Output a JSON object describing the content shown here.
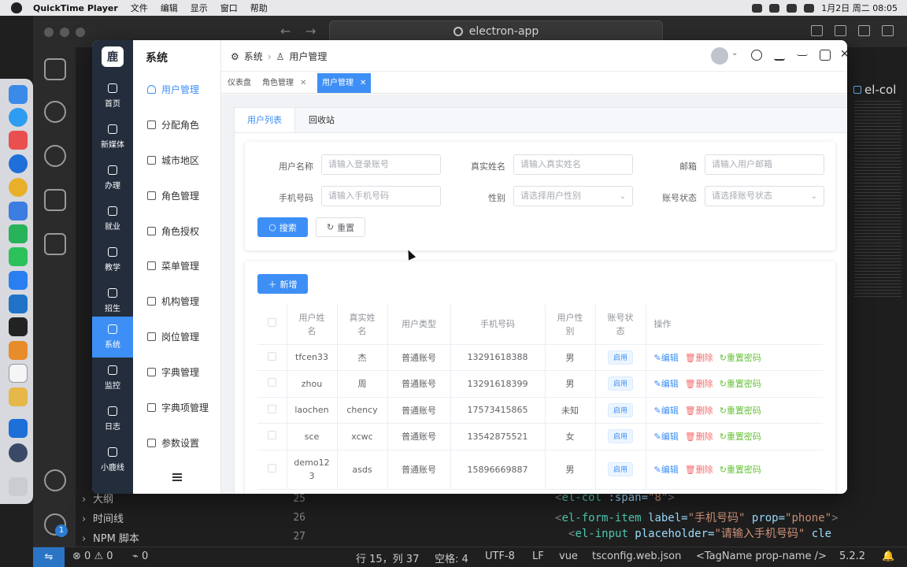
{
  "menubar": {
    "app": "QuickTime Player",
    "items": [
      "文件",
      "编辑",
      "显示",
      "窗口",
      "帮助"
    ],
    "clock": "1月2日 周二  08:05"
  },
  "vscode": {
    "search": "electron-app",
    "right_tab": "el-col",
    "sidebar_items": [
      "大纲",
      "时间线",
      "NPM 脚本"
    ],
    "lines": [
      "25",
      "26",
      "27"
    ],
    "code": {
      "l25": {
        "open": "<",
        "tag": "el-col",
        "attr": " :span=",
        "val": "\"8\"",
        "close": ">"
      },
      "l26": {
        "open": "<",
        "tag": "el-form-item",
        "attr1": " label=",
        "val1": "\"手机号码\"",
        "attr2": " prop=",
        "val2": "\"phone\"",
        "close": ">"
      },
      "l27": {
        "open": "<",
        "tag": "el-input",
        "attr": " placeholder=",
        "val": "\"请输入手机号码\"",
        "rest": " cle"
      }
    },
    "badge": "1",
    "status": {
      "errors": "0",
      "warnings": "0",
      "ports": "0",
      "pos": "行 15，列 37",
      "spaces": "空格: 4",
      "enc": "UTF-8",
      "eol": "LF",
      "lang": "vue",
      "tsconfig": "tsconfig.web.json",
      "tag": "<TagName prop-name />",
      "ver": "5.2.2"
    }
  },
  "app": {
    "logo": "鹿",
    "nav": [
      "首页",
      "新媒体",
      "办理",
      "就业",
      "教学",
      "招生",
      "系统",
      "监控",
      "日志",
      "小鹿线"
    ],
    "nav_active": 6,
    "section": "系统",
    "submenu": [
      "用户管理",
      "分配角色",
      "城市地区",
      "角色管理",
      "角色授权",
      "菜单管理",
      "机构管理",
      "岗位管理",
      "字典管理",
      "字典项管理",
      "参数设置"
    ],
    "breadcrumb": [
      "系统",
      "用户管理"
    ],
    "tags": [
      "仪表盘",
      "角色管理",
      "用户管理"
    ],
    "tabs": [
      "用户列表",
      "回收站"
    ],
    "form": {
      "username_label": "用户名称",
      "username_ph": "请输入登录账号",
      "realname_label": "真实姓名",
      "realname_ph": "请输入真实姓名",
      "email_label": "邮箱",
      "email_ph": "请输入用户邮箱",
      "phone_label": "手机号码",
      "phone_ph": "请输入手机号码",
      "gender_label": "性别",
      "gender_ph": "请选择用户性别",
      "status_label": "账号状态",
      "status_ph": "请选择账号状态",
      "search": "搜索",
      "reset": "重置"
    },
    "add": "新增",
    "table": {
      "headers": [
        "用户姓\n名",
        "真实姓\n名",
        "用户类型",
        "手机号码",
        "用户性\n别",
        "账号状\n态",
        "操作"
      ],
      "rows": [
        {
          "user": "tfcen33",
          "real": "杰",
          "type": "普通账号",
          "phone": "13291618388",
          "gender": "男",
          "status": "启用"
        },
        {
          "user": "zhou",
          "real": "周",
          "type": "普通账号",
          "phone": "13291618399",
          "gender": "男",
          "status": "启用"
        },
        {
          "user": "laochen",
          "real": "chency",
          "type": "普通账号",
          "phone": "17573415865",
          "gender": "未知",
          "status": "启用"
        },
        {
          "user": "sce",
          "real": "xcwc",
          "type": "普通账号",
          "phone": "13542875521",
          "gender": "女",
          "status": "启用"
        },
        {
          "user": "demo12\n3",
          "real": "asds",
          "type": "普通账号",
          "phone": "15896669887",
          "gender": "男",
          "status": "启用"
        }
      ],
      "ops": {
        "edit": "编辑",
        "delete": "删除",
        "reset": "重置密码"
      }
    }
  }
}
